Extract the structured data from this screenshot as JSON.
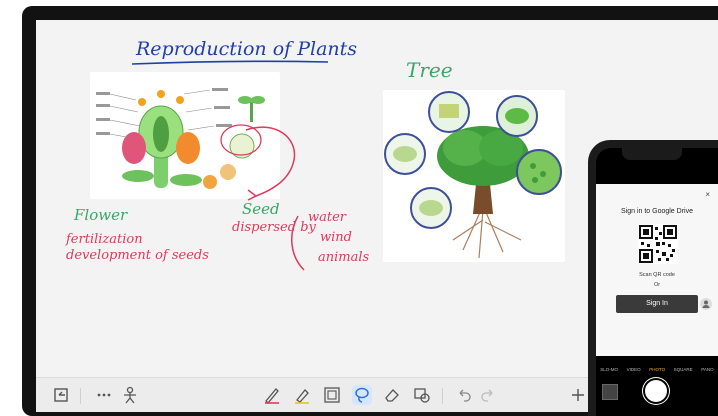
{
  "canvas": {
    "title": "Reproduction of Plants",
    "tree_label": "Tree",
    "flower_label": "Flower",
    "flower_notes": [
      "fertilization",
      "development of seeds"
    ],
    "seed_label": "Seed",
    "dispersed_label": "dispersed by",
    "dispersed_agents": [
      "water",
      "wind",
      "animals"
    ]
  },
  "colors": {
    "title_ink": "#1f3ea8",
    "green_ink": "#3aa66a",
    "red_ink": "#dc3b5b",
    "active_tool": "#d7e6ff"
  },
  "toolbar": {
    "items": [
      "undo-panel-icon",
      "more-icon",
      "person-icon",
      "pen-icon",
      "highlighter-icon",
      "grid-icon",
      "lasso-icon",
      "eraser-icon",
      "shapes-icon",
      "undo-icon",
      "redo-icon",
      "add-icon"
    ],
    "active": "lasso-icon"
  },
  "phone": {
    "sheet_title": "Sign in to Google Drive",
    "scan_text": "Scan QR code",
    "or_text": "Or",
    "signin_label": "Sign In",
    "close_label": "×",
    "modes": [
      "SLO-MO",
      "VIDEO",
      "PHOTO",
      "SQUARE",
      "PANO"
    ],
    "active_mode": "PHOTO"
  }
}
